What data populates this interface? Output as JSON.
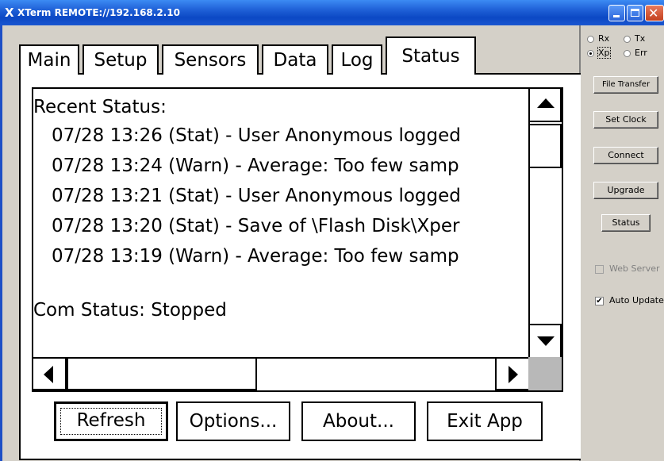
{
  "window": {
    "app_icon": "X",
    "title": "XTerm REMOTE://192.168.2.10"
  },
  "tabs": [
    {
      "label": "Main"
    },
    {
      "label": "Setup"
    },
    {
      "label": "Sensors"
    },
    {
      "label": "Data"
    },
    {
      "label": "Log"
    },
    {
      "label": "Status",
      "selected": true
    }
  ],
  "status": {
    "recent_heading": "Recent Status:",
    "entries": [
      "07/28 13:26 (Stat) - User Anonymous logged",
      "07/28 13:24 (Warn) - Average: Too few samp",
      "07/28 13:21 (Stat) - User Anonymous logged",
      "07/28 13:20 (Stat) - Save of \\Flash Disk\\Xper",
      "07/28 13:19 (Warn) - Average: Too few samp"
    ],
    "com_status": "Com Status: Stopped"
  },
  "buttons": {
    "refresh": "Refresh",
    "options": "Options...",
    "about": "About...",
    "exit": "Exit App"
  },
  "side_panel": {
    "radios": [
      {
        "label": "Rx",
        "checked": false
      },
      {
        "label": "Tx",
        "checked": false
      },
      {
        "label": "Xp",
        "checked": true
      },
      {
        "label": "Err",
        "checked": false
      }
    ],
    "file_transfer": "File Transfer",
    "set_clock": "Set Clock",
    "connect": "Connect",
    "upgrade": "Upgrade",
    "status": "Status",
    "web_server": {
      "label": "Web Server",
      "checked": false,
      "enabled": false
    },
    "auto_update": {
      "label": "Auto Update",
      "checked": true,
      "enabled": true
    }
  },
  "colors": {
    "titlebar": "#0b48c4",
    "dialog_bg": "#d4d0c8",
    "disabled_text": "#808080"
  }
}
